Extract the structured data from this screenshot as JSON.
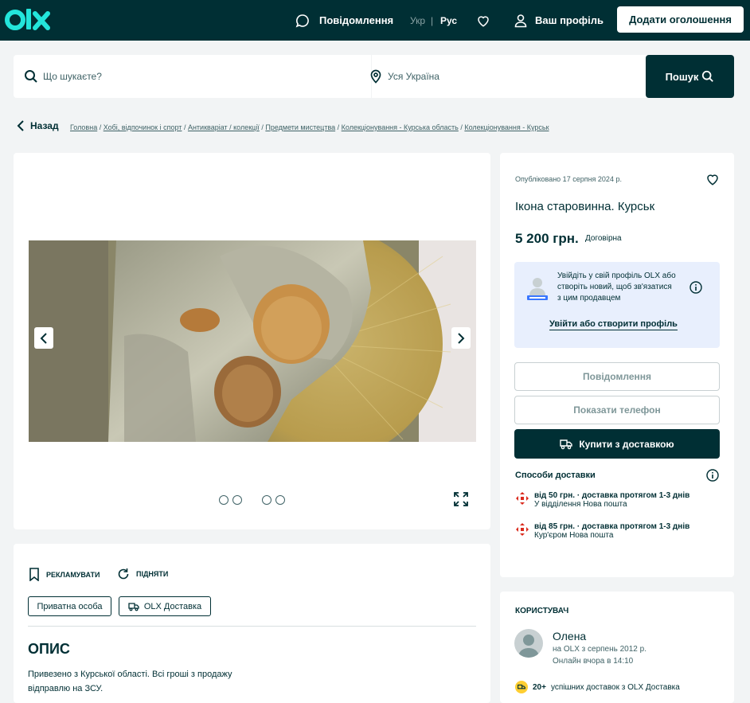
{
  "header": {
    "logo": "olx",
    "messages_label": "Повідомлення",
    "lang_ukr": "Укр",
    "lang_sep": "|",
    "lang_rus": "Рус",
    "profile_label": "Ваш профіль",
    "add_button": "Додати оголошення"
  },
  "search": {
    "query_placeholder": "Що шукаєте?",
    "location_value": "Уся Україна",
    "button_label": "Пошук"
  },
  "back_label": "Назад",
  "breadcrumbs": [
    "Головна",
    "Хобі, відпочинок і спорт",
    "Антикваріат / колекції",
    "Предмети мистецтва",
    "Колекціонування - Курська область",
    "Колекціонування - Курськ"
  ],
  "listing": {
    "published": "Опубліковано 17 серпня 2024 р.",
    "title": "Ікона старовинна. Курськ",
    "price": "5 200 грн.",
    "negotiable": "Договірна",
    "login_prompt": "Увійдіть у свій профіль OLX або створіть новий, щоб зв'язатися з цим продавцем",
    "login_link": "Увійти або створити профіль",
    "message_button": "Повідомлення",
    "phone_button": "Показати телефон",
    "buy_button": "Купити з доставкою",
    "delivery_title": "Способи доставки",
    "delivery": [
      {
        "line1": "від 50 грн. · доставка протягом 1-3 днів",
        "line2": "У відділення Нова пошта"
      },
      {
        "line1": "від 85 грн. · доставка протягом 1-3 днів",
        "line2": "Кур'єром Нова пошта"
      }
    ]
  },
  "actions": {
    "promote": "РЕКЛАМУВАТИ",
    "raise": "ПІДНЯТИ"
  },
  "tags": {
    "private": "Приватна особа",
    "olx_delivery": "OLX Доставка"
  },
  "description": {
    "heading": "ОПИС",
    "text_line1": "Привезено з Курської області. Всі гроші з продажу",
    "text_line2": "відправлю на ЗСУ."
  },
  "seller": {
    "section_title": "КОРИСТУВАЧ",
    "name": "Олена",
    "since": "на OLX з серпень 2012 р.",
    "online": "Онлайн вчора в 14:10",
    "deliveries_count": "20+",
    "deliveries_text": "успішних доставок з OLX Доставка"
  },
  "colors": {
    "brand_dark": "#002f34",
    "brand_teal": "#23e5db",
    "login_bg": "#e8effd",
    "np_red": "#da291c",
    "badge_yellow": "#ffce32"
  }
}
